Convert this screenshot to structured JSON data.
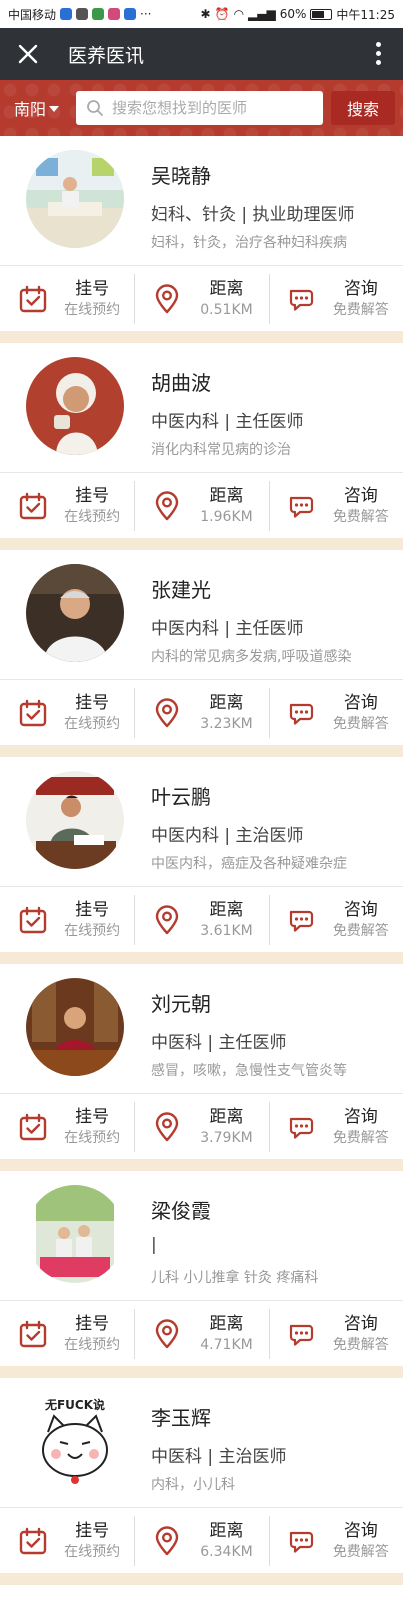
{
  "status": {
    "carrier": "中国移动",
    "battery": "60%",
    "time": "中午11:25"
  },
  "header": {
    "title": "医养医讯"
  },
  "search": {
    "city": "南阳",
    "placeholder": "搜索您想找到的医师",
    "button": "搜索"
  },
  "actions": {
    "register": "挂号",
    "register_sub": "在线预约",
    "distance": "距离",
    "consult": "咨询",
    "consult_sub": "免费解答"
  },
  "doctors": [
    {
      "name": "吴晓静",
      "title": "妇科、针灸 | 执业助理医师",
      "desc": "妇科，针灸，治疗各种妇科疾病",
      "distance": "0.51KM"
    },
    {
      "name": "胡曲波",
      "title": "中医内科 | 主任医师",
      "desc": "消化内科常见病的诊治",
      "distance": "1.96KM"
    },
    {
      "name": "张建光",
      "title": "中医内科 | 主任医师",
      "desc": "内科的常见病多发病,呼吸道感染",
      "distance": "3.23KM"
    },
    {
      "name": "叶云鹏",
      "title": "中医内科 | 主治医师",
      "desc": "中医内科，癌症及各种疑难杂症",
      "distance": "3.61KM"
    },
    {
      "name": "刘元朝",
      "title": "中医科 | 主任医师",
      "desc": "感冒，咳嗽，急慢性支气管炎等",
      "distance": "3.79KM"
    },
    {
      "name": "梁俊霞",
      "title": "|",
      "desc": "儿科 小儿推拿 针灸 疼痛科",
      "distance": "4.71KM"
    },
    {
      "name": "李玉辉",
      "title": "中医科 | 主治医师",
      "desc": "内科，小儿科",
      "distance": "6.34KM",
      "avatar_text": "无FUCK说"
    }
  ]
}
